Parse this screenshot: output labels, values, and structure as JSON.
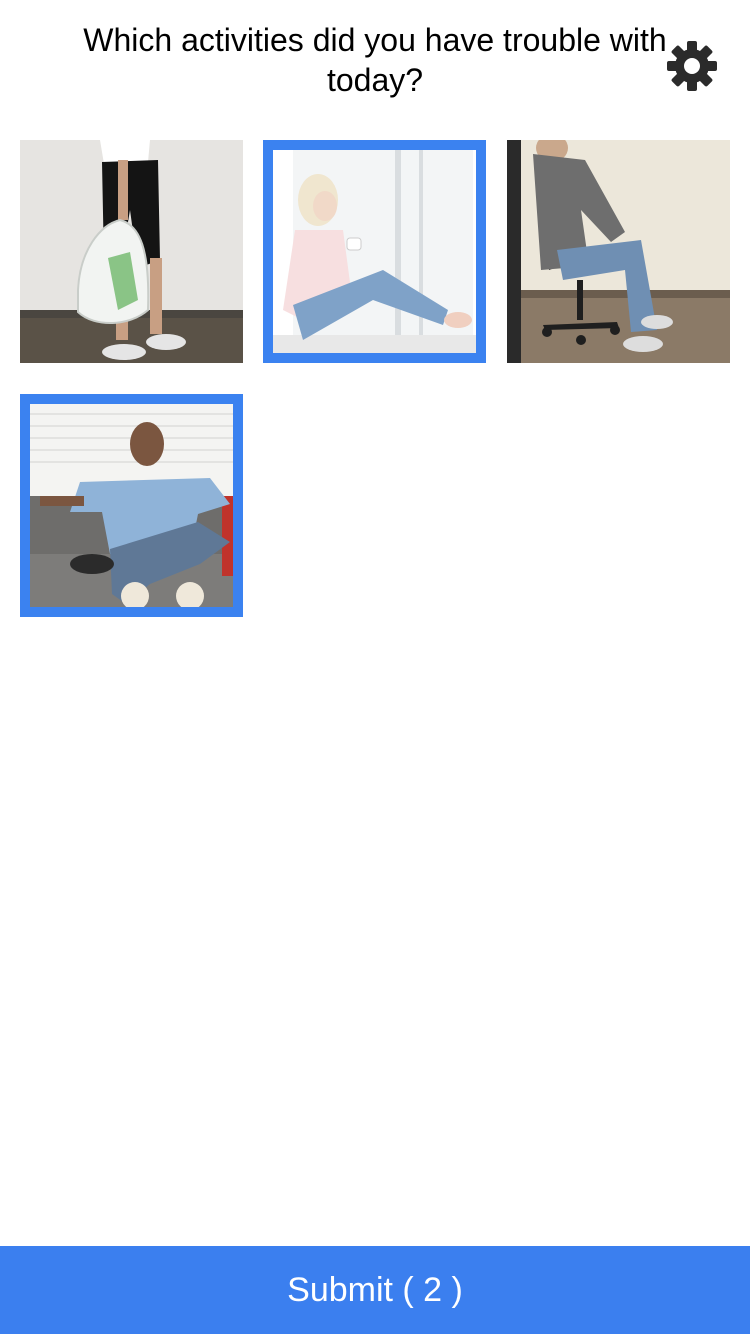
{
  "header": {
    "title": "Which activities did you have trouble with today?",
    "settings_icon": "gear-icon"
  },
  "activities": [
    {
      "name": "carrying-groceries",
      "selected": false
    },
    {
      "name": "sitting-on-floor",
      "selected": true
    },
    {
      "name": "sitting-in-chair",
      "selected": false
    },
    {
      "name": "sitting-on-couch",
      "selected": true
    }
  ],
  "footer": {
    "submit_label": "Submit ( 2 )"
  },
  "colors": {
    "accent": "#3b82f0",
    "submit_bg": "#3b7fef"
  }
}
